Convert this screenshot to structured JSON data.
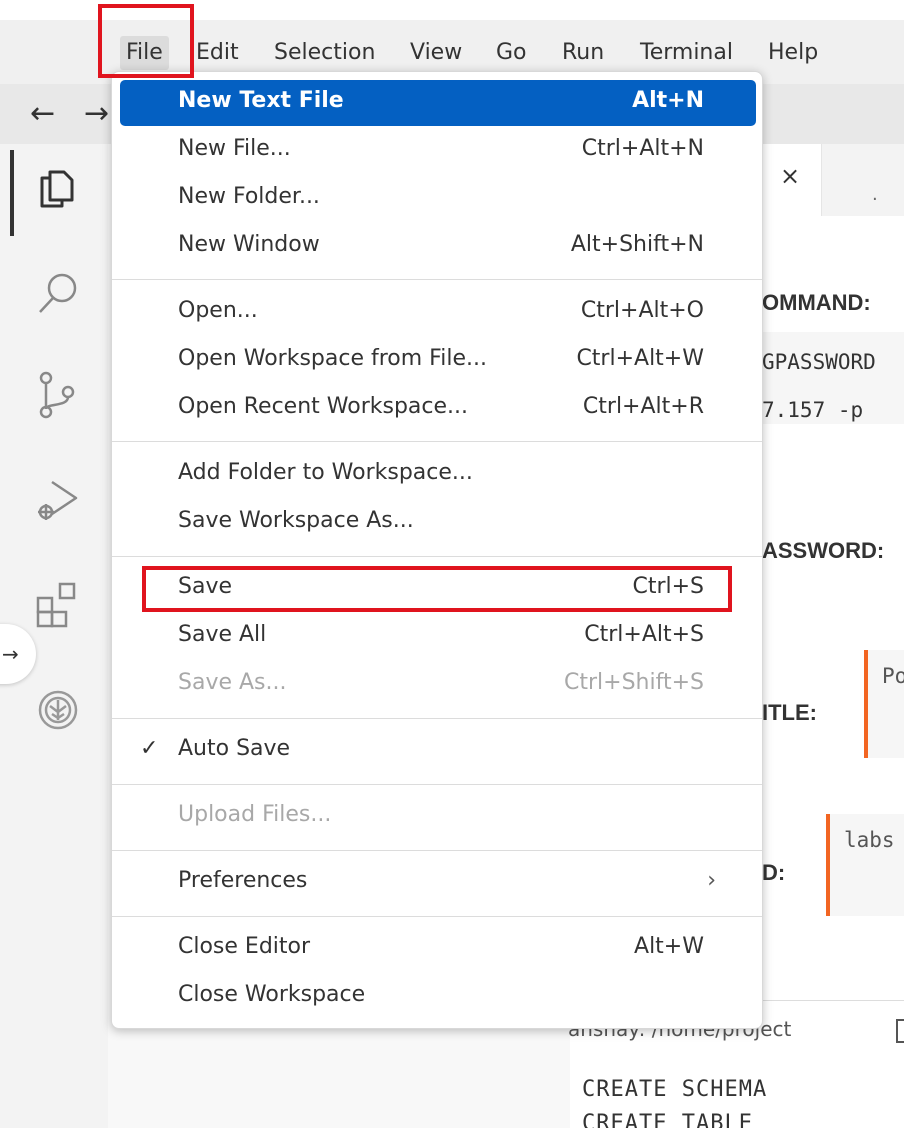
{
  "menubar": {
    "items": [
      "File",
      "Edit",
      "Selection",
      "View",
      "Go",
      "Run",
      "Terminal",
      "Help"
    ]
  },
  "nav": {
    "back": "←",
    "forward": "→"
  },
  "file_menu": {
    "items": [
      {
        "label": "New Text File",
        "shortcut": "Alt+N"
      },
      {
        "label": "New File...",
        "shortcut": "Ctrl+Alt+N"
      },
      {
        "label": "New Folder...",
        "shortcut": ""
      },
      {
        "label": "New Window",
        "shortcut": "Alt+Shift+N"
      },
      {
        "label": "Open...",
        "shortcut": "Ctrl+Alt+O"
      },
      {
        "label": "Open Workspace from File...",
        "shortcut": "Ctrl+Alt+W"
      },
      {
        "label": "Open Recent Workspace...",
        "shortcut": "Ctrl+Alt+R"
      },
      {
        "label": "Add Folder to Workspace...",
        "shortcut": ""
      },
      {
        "label": "Save Workspace As...",
        "shortcut": ""
      },
      {
        "label": "Save",
        "shortcut": "Ctrl+S"
      },
      {
        "label": "Save All",
        "shortcut": "Ctrl+Alt+S"
      },
      {
        "label": "Save As...",
        "shortcut": "Ctrl+Shift+S"
      },
      {
        "label": "Auto Save",
        "shortcut": ""
      },
      {
        "label": "Upload Files...",
        "shortcut": ""
      },
      {
        "label": "Preferences",
        "shortcut": ""
      },
      {
        "label": "Close Editor",
        "shortcut": "Alt+W"
      },
      {
        "label": "Close Workspace",
        "shortcut": ""
      }
    ],
    "check_glyph": "✓",
    "submenu_glyph": "›"
  },
  "editor": {
    "tab_close": "×",
    "tab_dot": ".",
    "heading1": "OMMAND:",
    "code1": "GPASSWORD",
    "code2": "7.157 -p",
    "heading2": "ASSWORD:",
    "heading3": "ITLE:",
    "box1_text": "Po",
    "heading4": "D:",
    "box2_text": "labs"
  },
  "terminal": {
    "title": "anshay: /home/project",
    "line1": "CREATE SCHEMA",
    "line2": "CREATE TABLE"
  },
  "colors": {
    "highlight": "#0460c2",
    "annotation_red": "#e0141e",
    "accent_orange": "#f26522"
  }
}
